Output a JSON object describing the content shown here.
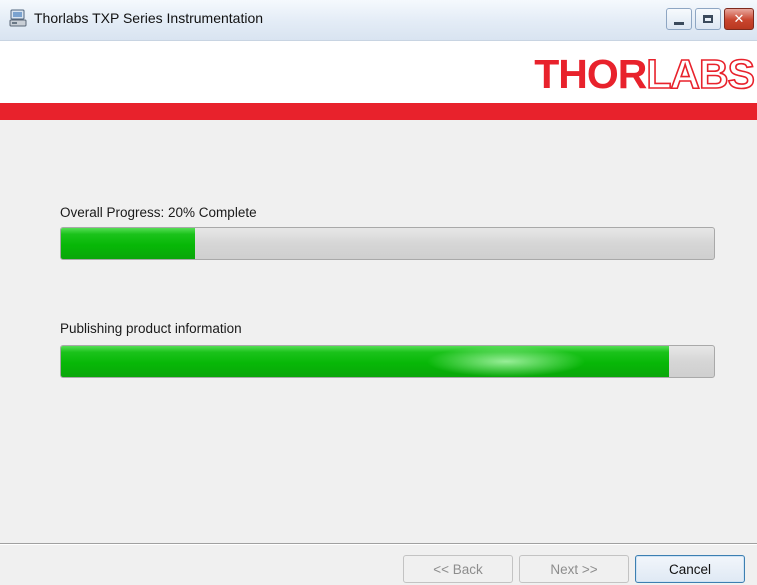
{
  "window": {
    "title": "Thorlabs TXP Series Instrumentation",
    "close_glyph": "✕"
  },
  "header": {
    "logo_solid": "THOR",
    "logo_outline": "LABS",
    "accent_color": "#e8222c"
  },
  "progress": {
    "overall_label": "Overall Progress: 20% Complete",
    "overall_fraction": 0.205,
    "task_label": "Publishing product information",
    "task_fraction": 0.931
  },
  "buttons": {
    "back": "<< Back",
    "next": "Next >>",
    "cancel": "Cancel"
  },
  "icons": [
    "app-installer-icon",
    "minimize-icon",
    "maximize-icon",
    "close-icon"
  ]
}
